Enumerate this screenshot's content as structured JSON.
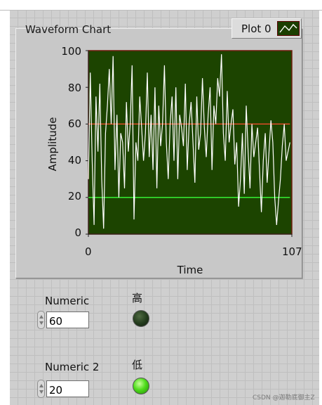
{
  "chart": {
    "title": "Waveform Chart",
    "legend_label": "Plot 0",
    "ylabel": "Amplitude",
    "xlabel": "Time",
    "y_ticks": [
      "100",
      "80",
      "60",
      "40",
      "20",
      "0"
    ],
    "x_ticks": [
      "0",
      "107"
    ]
  },
  "chart_data": {
    "type": "line",
    "title": "Waveform Chart",
    "xlabel": "Time",
    "ylabel": "Amplitude",
    "xlim": [
      0,
      107
    ],
    "ylim": [
      0,
      100
    ],
    "grid": false,
    "legend": "top-right",
    "series": [
      {
        "name": "Plot 0",
        "color": "#ffffff",
        "x": [
          0,
          1,
          2,
          3,
          4,
          5,
          6,
          7,
          8,
          9,
          10,
          11,
          12,
          13,
          14,
          15,
          16,
          17,
          18,
          19,
          20,
          21,
          22,
          23,
          24,
          25,
          26,
          27,
          28,
          29,
          30,
          31,
          32,
          33,
          34,
          35,
          36,
          37,
          38,
          39,
          40,
          41,
          42,
          43,
          44,
          45,
          46,
          47,
          48,
          49,
          50,
          51,
          52,
          53,
          54,
          55,
          56,
          57,
          58,
          59,
          60,
          61,
          62,
          63,
          64,
          65,
          66,
          67,
          68,
          69,
          70,
          71,
          72,
          73,
          74,
          75,
          76,
          77,
          78,
          79,
          80,
          81,
          82,
          83,
          84,
          85,
          86,
          87,
          88,
          89,
          90,
          91,
          92,
          93,
          94,
          95,
          96,
          97,
          98,
          99,
          100,
          101,
          102,
          103,
          104,
          105,
          106
        ],
        "values": [
          30,
          88,
          40,
          5,
          75,
          45,
          82,
          30,
          3,
          55,
          70,
          90,
          60,
          97,
          35,
          65,
          20,
          55,
          50,
          25,
          72,
          45,
          60,
          92,
          8,
          50,
          40,
          75,
          58,
          40,
          55,
          88,
          42,
          65,
          35,
          80,
          25,
          70,
          48,
          60,
          92,
          50,
          30,
          60,
          75,
          40,
          80,
          30,
          65,
          58,
          48,
          82,
          35,
          60,
          72,
          50,
          28,
          75,
          46,
          55,
          85,
          58,
          42,
          65,
          80,
          35,
          70,
          60,
          85,
          75,
          98,
          55,
          40,
          78,
          50,
          60,
          68,
          38,
          50,
          15,
          30,
          55,
          22,
          70,
          45,
          25,
          60,
          42,
          50,
          58,
          35,
          12,
          40,
          55,
          28,
          45,
          62,
          50,
          20,
          5,
          18,
          30,
          48,
          60,
          40,
          45,
          50
        ]
      }
    ],
    "reference_lines": [
      {
        "value": 60,
        "color": "#ff4c2e"
      },
      {
        "value": 20,
        "color": "#39ff39"
      }
    ]
  },
  "controls": {
    "numeric": {
      "label": "Numeric",
      "value": "60"
    },
    "numeric2": {
      "label": "Numeric 2",
      "value": "20"
    }
  },
  "leds": {
    "high": {
      "label": "高",
      "state": "off"
    },
    "low": {
      "label": "低",
      "state": "on"
    }
  },
  "watermark": "CSDN @迦勒底御主Z"
}
